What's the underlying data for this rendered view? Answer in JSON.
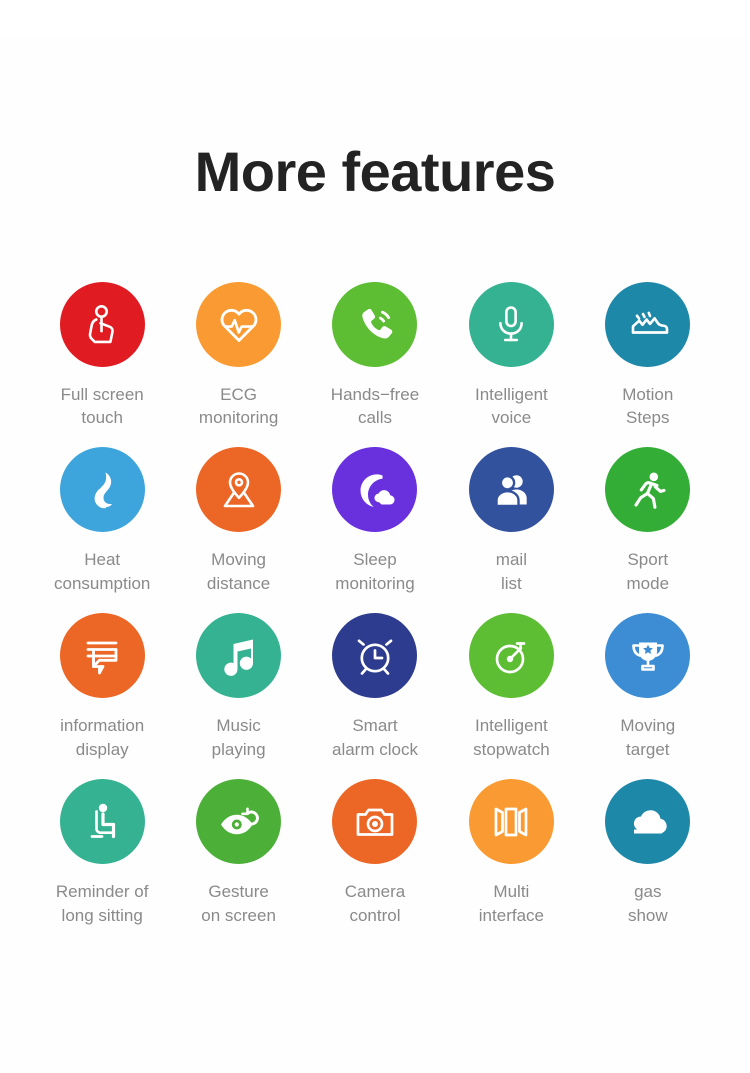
{
  "header": {
    "title": "More features"
  },
  "features": [
    {
      "label": "Full screen\ntouch",
      "icon": "touch-gesture-icon",
      "color": "#E11B22"
    },
    {
      "label": "ECG\nmonitoring",
      "icon": "heart-pulse-icon",
      "color": "#F99B32"
    },
    {
      "label": "Hands−free\ncalls",
      "icon": "phone-call-icon",
      "color": "#5DBD33"
    },
    {
      "label": "Intelligent\nvoice",
      "icon": "microphone-icon",
      "color": "#34B291"
    },
    {
      "label": "Motion\nSteps",
      "icon": "sneaker-shoe-icon",
      "color": "#1E88A8"
    },
    {
      "label": "Heat\nconsumption",
      "icon": "flame-drop-icon",
      "color": "#3DA5DC"
    },
    {
      "label": "Moving\ndistance",
      "icon": "map-location-pin-icon",
      "color": "#EC6625"
    },
    {
      "label": "Sleep\nmonitoring",
      "icon": "moon-cloud-icon",
      "color": "#6930DE"
    },
    {
      "label": "mail\nlist",
      "icon": "contacts-people-icon",
      "color": "#33529E"
    },
    {
      "label": "Sport\nmode",
      "icon": "running-person-icon",
      "color": "#34AD36"
    },
    {
      "label": "information\ndisplay",
      "icon": "message-bubble-icon",
      "color": "#EC6625"
    },
    {
      "label": "Music\nplaying",
      "icon": "music-note-icon",
      "color": "#34B291"
    },
    {
      "label": "Smart\nalarm clock",
      "icon": "alarm-clock-icon",
      "color": "#2E3C8F"
    },
    {
      "label": "Intelligent\nstopwatch",
      "icon": "stopwatch-icon",
      "color": "#5DBD33"
    },
    {
      "label": "Moving\ntarget",
      "icon": "trophy-icon",
      "color": "#3D8DD4"
    },
    {
      "label": "Reminder of\nlong sitting",
      "icon": "sitting-person-icon",
      "color": "#34B291"
    },
    {
      "label": "Gesture\non screen",
      "icon": "eye-refresh-icon",
      "color": "#4CB038"
    },
    {
      "label": "Camera\ncontrol",
      "icon": "camera-icon",
      "color": "#EC6625"
    },
    {
      "label": "Multi\ninterface",
      "icon": "multi-panel-carousel-icon",
      "color": "#F99B32"
    },
    {
      "label": "gas\nshow",
      "icon": "cloud-icon",
      "color": "#1E88A8"
    }
  ]
}
